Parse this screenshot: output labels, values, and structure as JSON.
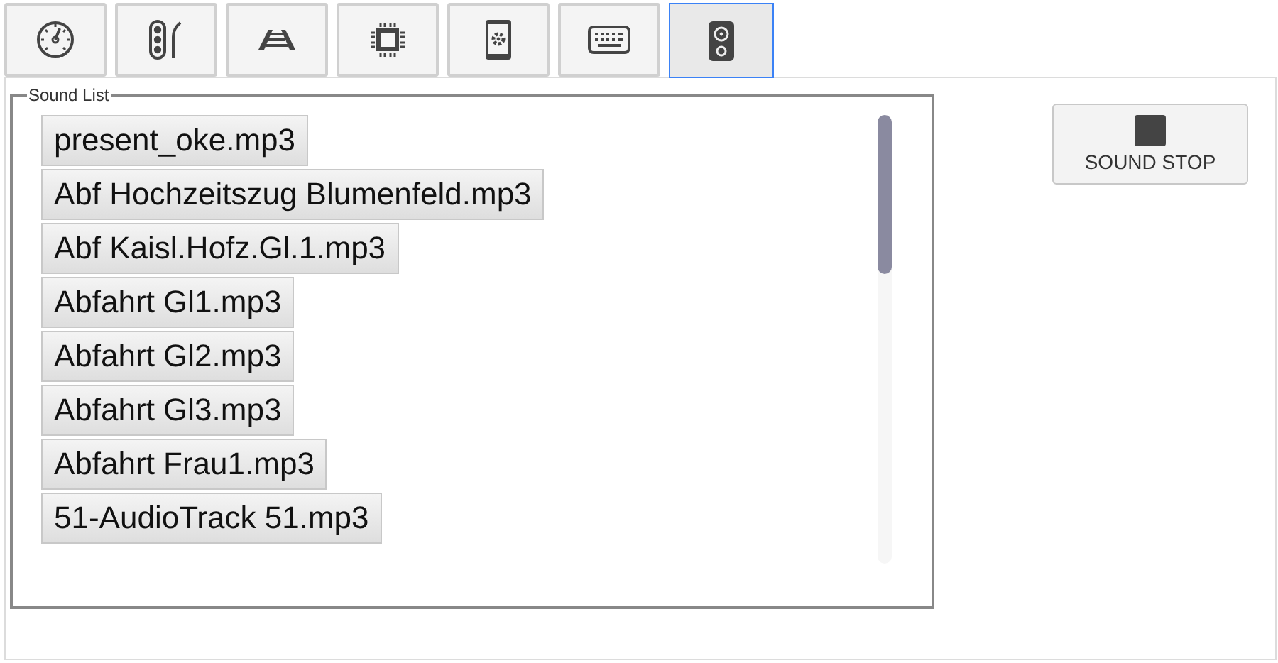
{
  "tabs": [
    {
      "kind": "gauge",
      "selected": false
    },
    {
      "kind": "signal",
      "selected": false
    },
    {
      "kind": "track",
      "selected": false
    },
    {
      "kind": "chip",
      "selected": false
    },
    {
      "kind": "phone",
      "selected": false
    },
    {
      "kind": "keyboard",
      "selected": false
    },
    {
      "kind": "speaker",
      "selected": true
    }
  ],
  "sound_list": {
    "title": "Sound List",
    "items": [
      "present_oke.mp3",
      "Abf Hochzeitszug Blumenfeld.mp3",
      "Abf Kaisl.Hofz.Gl.1.mp3",
      "Abfahrt Gl1.mp3",
      "Abfahrt Gl2.mp3",
      "Abfahrt Gl3.mp3",
      "Abfahrt Frau1.mp3",
      "51-AudioTrack 51.mp3"
    ]
  },
  "stop_button": {
    "label": "SOUND STOP"
  }
}
